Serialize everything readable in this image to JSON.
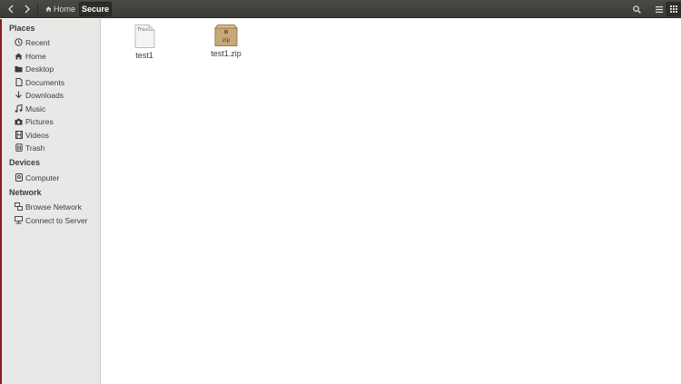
{
  "header": {
    "breadcrumb": {
      "home_label": "Home",
      "current_label": "Secure"
    },
    "icons": {
      "back": "chevron-left-icon",
      "forward": "chevron-right-icon",
      "home": "home-icon",
      "search": "search-icon",
      "menu": "hamburger-menu-icon",
      "view": "grid-view-icon"
    }
  },
  "sidebar": {
    "places_title": "Places",
    "places": [
      {
        "label": "Recent",
        "icon": "clock-icon"
      },
      {
        "label": "Home",
        "icon": "home-icon"
      },
      {
        "label": "Desktop",
        "icon": "folder-icon"
      },
      {
        "label": "Documents",
        "icon": "document-icon"
      },
      {
        "label": "Downloads",
        "icon": "download-icon"
      },
      {
        "label": "Music",
        "icon": "music-icon"
      },
      {
        "label": "Pictures",
        "icon": "camera-icon"
      },
      {
        "label": "Videos",
        "icon": "film-icon"
      },
      {
        "label": "Trash",
        "icon": "trash-icon"
      }
    ],
    "devices_title": "Devices",
    "devices": [
      {
        "label": "Computer",
        "icon": "drive-icon"
      }
    ],
    "network_title": "Network",
    "network": [
      {
        "label": "Browse Network",
        "icon": "network-icon"
      },
      {
        "label": "Connect to Server",
        "icon": "server-icon"
      }
    ]
  },
  "files": [
    {
      "name": "test1",
      "type": "text",
      "preview": "This",
      "icon": "text-file-icon"
    },
    {
      "name": "test1.zip",
      "type": "archive",
      "badge": "zip",
      "icon": "zip-archive-icon"
    }
  ],
  "colors": {
    "header_bg": "#3c3b37",
    "sidebar_bg": "#e8e8e7",
    "accent_red": "#8e1b1b"
  }
}
